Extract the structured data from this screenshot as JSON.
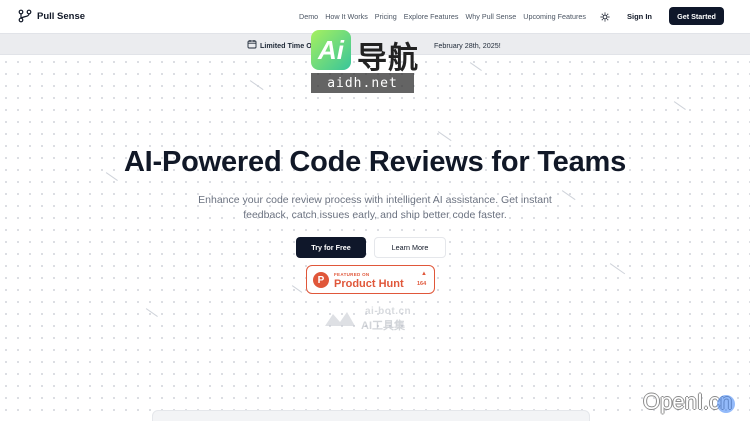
{
  "brand": {
    "name": "Pull Sense"
  },
  "nav": {
    "links": [
      "Demo",
      "How It Works",
      "Pricing",
      "Explore Features",
      "Why Pull Sense",
      "Upcoming Features"
    ],
    "sign_in": "Sign In",
    "get_started": "Get Started"
  },
  "banner": {
    "lead": "Limited Time Offer",
    "tail": "February 28th, 2025!"
  },
  "watermark": {
    "badge": "Ai",
    "cn": "导航",
    "url": "aidh.net"
  },
  "hero": {
    "title": "AI-Powered Code Reviews for Teams",
    "subtitle": "Enhance your code review process with intelligent AI assistance. Get instant feedback, catch issues early, and ship better code faster.",
    "primary_cta": "Try for Free",
    "secondary_cta": "Learn More"
  },
  "product_hunt": {
    "featured_on": "FEATURED ON",
    "name": "Product Hunt",
    "votes": "164",
    "color": "#e0573a"
  },
  "watermark2": {
    "line1": "ai-bot.cn",
    "line2": "AI工具集"
  },
  "corner_mark": "OpenI.cn",
  "icons": [
    "logo-icon",
    "sun-icon",
    "calendar-icon",
    "upvote-icon"
  ]
}
